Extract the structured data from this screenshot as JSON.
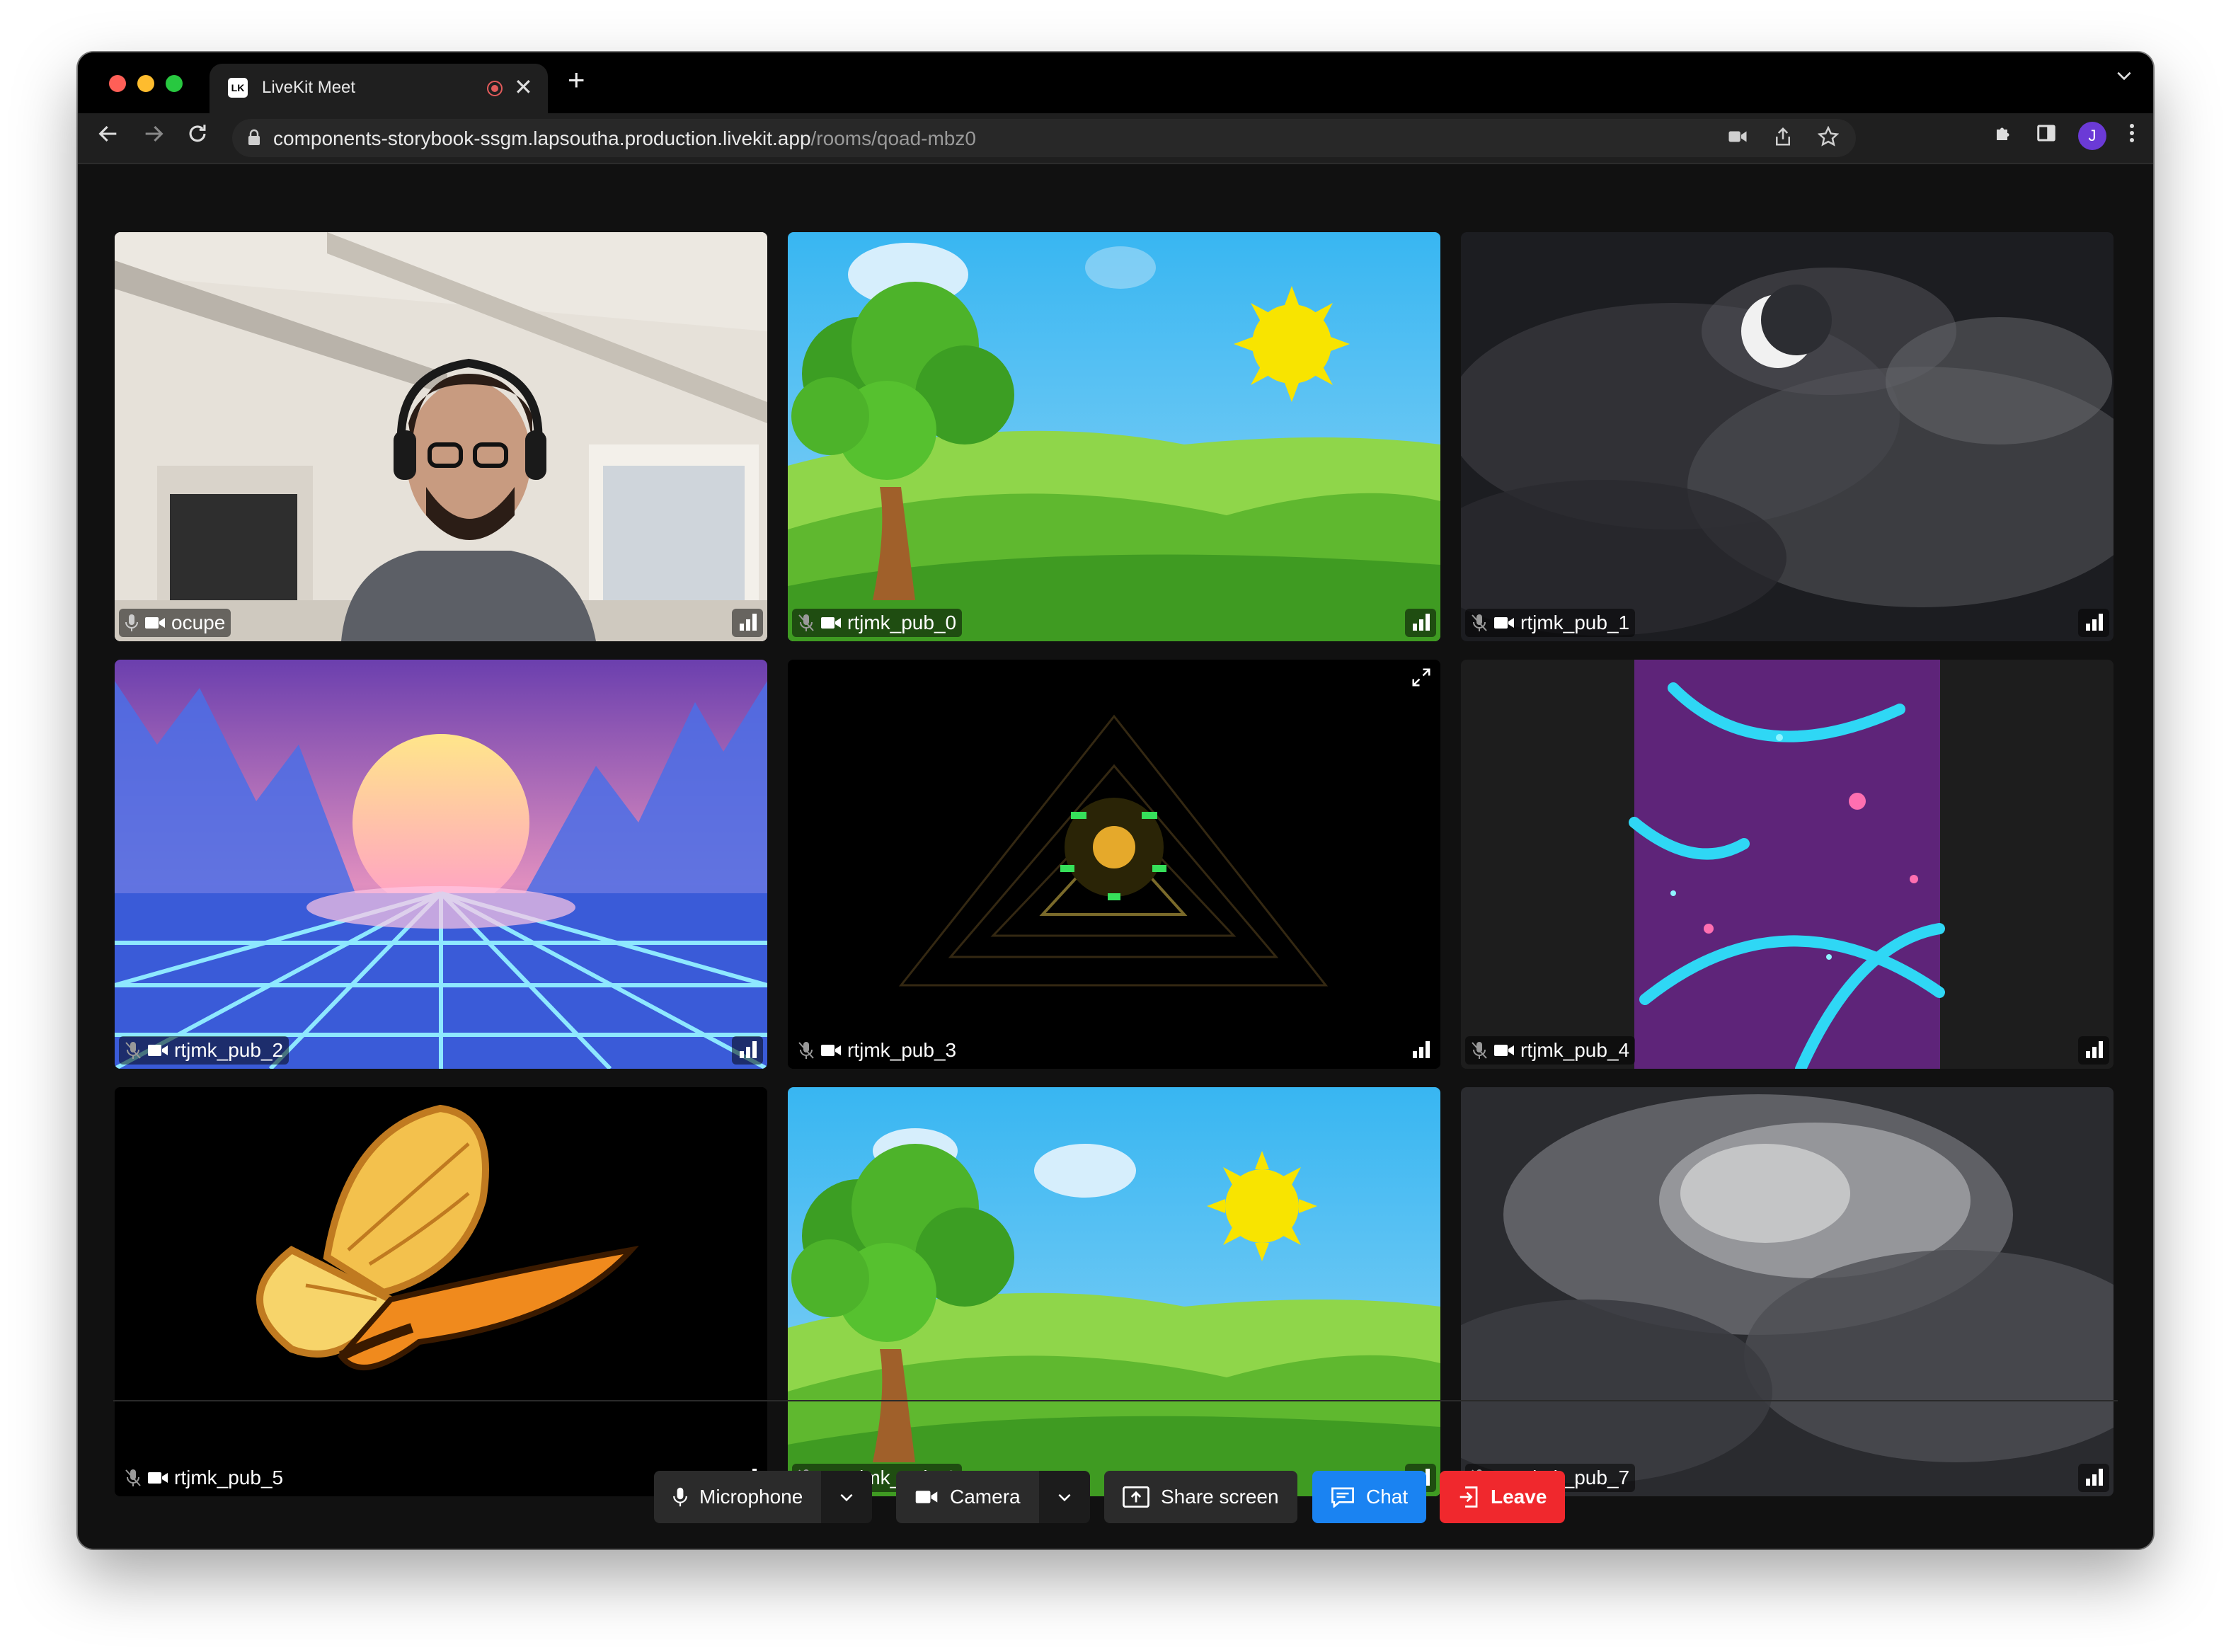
{
  "browser": {
    "tab_title": "LiveKit Meet",
    "tab_favicon_letter": "LK",
    "tab_close": "✕",
    "new_tab": "+",
    "url_host": "components-storybook-ssgm.lapsoutha.production.livekit.app",
    "url_path": "/rooms/qoad-mbz0",
    "avatar_letter": "J"
  },
  "colors": {
    "chat_button": "#1a83f2",
    "leave_button": "#f0282d",
    "control_button": "#2b2b2b",
    "stage_background": "#111111"
  },
  "participants": [
    {
      "name": "ocupe",
      "video": "person-headphones-room",
      "mic_muted": false
    },
    {
      "name": "rtjmk_pub_0",
      "video": "cartoon-tree-sun-landscape",
      "mic_muted": true
    },
    {
      "name": "rtjmk_pub_1",
      "video": "moon-night-clouds",
      "mic_muted": true
    },
    {
      "name": "rtjmk_pub_2",
      "video": "retro-synthwave-sun-grid",
      "mic_muted": true
    },
    {
      "name": "rtjmk_pub_3",
      "video": "kaleidoscope-tunnel",
      "mic_muted": true
    },
    {
      "name": "rtjmk_pub_4",
      "video": "neon-swirls-portrait",
      "mic_muted": true
    },
    {
      "name": "rtjmk_pub_5",
      "video": "monarch-butterfly",
      "mic_muted": true
    },
    {
      "name": "rtjmk_pub_6",
      "video": "cartoon-tree-sun-landscape",
      "mic_muted": true
    },
    {
      "name": "rtjmk_pub_7",
      "video": "grey-clouds",
      "mic_muted": true
    }
  ],
  "controls": {
    "microphone": "Microphone",
    "camera": "Camera",
    "share_screen": "Share screen",
    "chat": "Chat",
    "leave": "Leave"
  }
}
